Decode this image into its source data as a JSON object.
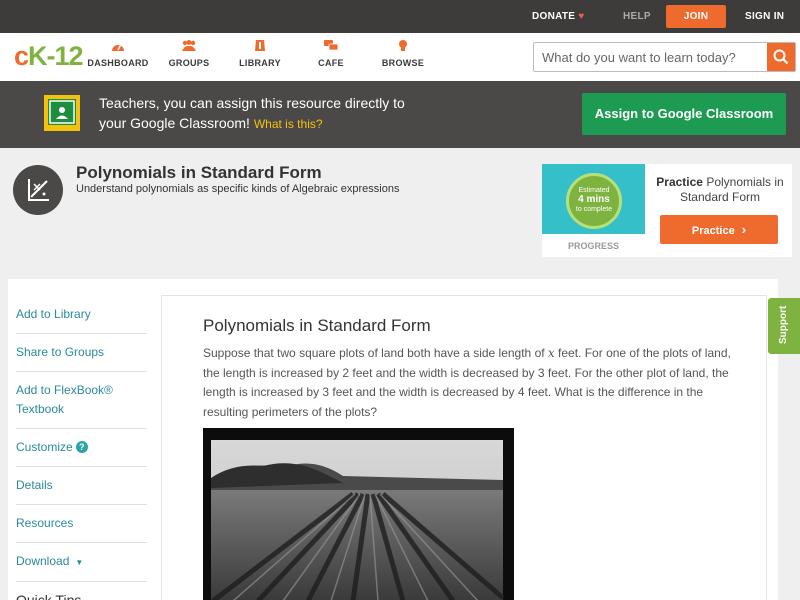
{
  "topbar": {
    "donate": "DONATE",
    "help": "HELP",
    "join": "JOIN",
    "signin": "SIGN IN"
  },
  "logo": {
    "part1": "c",
    "part2": "K",
    "part3": "-",
    "part4": "12"
  },
  "nav": {
    "dashboard": "DASHBOARD",
    "groups": "GROUPS",
    "library": "LIBRARY",
    "cafe": "CAFE",
    "browse": "BROWSE"
  },
  "search": {
    "placeholder": "What do you want to learn today?"
  },
  "banner": {
    "line1": "Teachers, you can assign this resource directly to",
    "line2": "your Google Classroom!",
    "what": "What is this?",
    "button": "Assign to Google Classroom"
  },
  "concept": {
    "title": "Polynomials in Standard Form",
    "subtitle": "Understand polynomials as specific kinds of Algebraic expressions"
  },
  "practice_card": {
    "est1": "Estimated",
    "est2": "4 mins",
    "est3": "to complete",
    "progress": "PROGRESS",
    "title_bold": "Practice",
    "title_rest": "Polynomials in Standard Form",
    "button": "Practice"
  },
  "sidebar": {
    "items": [
      {
        "label": "Add to Library"
      },
      {
        "label": "Share to Groups"
      },
      {
        "label": "Add to FlexBook® Textbook"
      },
      {
        "label": "Customize"
      },
      {
        "label": "Details"
      },
      {
        "label": "Resources"
      },
      {
        "label": "Download"
      }
    ],
    "quick_tips": "Quick Tips"
  },
  "lesson": {
    "title": "Polynomials in Standard Form",
    "body_pre": "Suppose that two square plots of land both have a side length of",
    "variable": "x",
    "body_post": "feet. For one of the plots of land, the length is increased by 2 feet and the width is decreased by 3 feet. For the other plot of land, the length is increased by 3 feet and the width is decreased by 4 feet. What is the difference in the resulting perimeters of the plots?"
  },
  "support": "Support",
  "colors": {
    "brand_orange": "#ee6b2d",
    "brand_green": "#7fb33f",
    "classroom_green": "#1e9b52",
    "link_teal": "#2a8a9c"
  }
}
